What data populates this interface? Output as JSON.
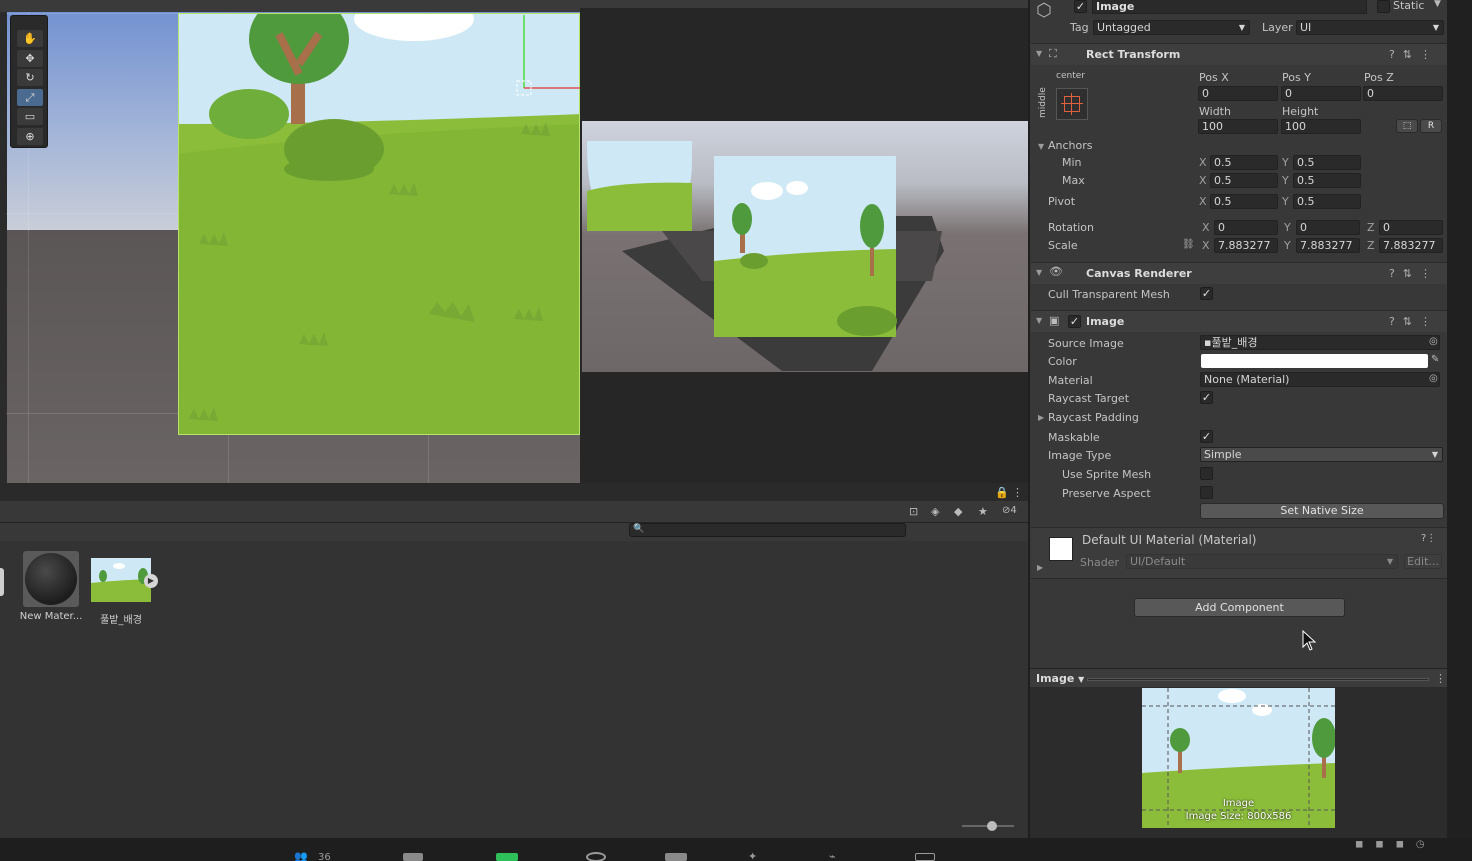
{
  "scene": {
    "tools": [
      "hand-tool",
      "move-tool",
      "rotate-tool",
      "scale-tool",
      "rect-tool",
      "transform-tool"
    ]
  },
  "game": {},
  "project": {
    "hidden_count": "4",
    "assets": [
      {
        "label": "New Mater...",
        "icon": "material-sphere-icon"
      },
      {
        "label": "풀밭_배경",
        "icon": "sprite-thumbnail-icon"
      }
    ]
  },
  "inspector": {
    "object_name": "Image",
    "static_label": "Static",
    "tag_label": "Tag",
    "tag_value": "Untagged",
    "layer_label": "Layer",
    "layer_value": "UI",
    "rect_transform": {
      "title": "Rect Transform",
      "anchor_h": "center",
      "anchor_v": "middle",
      "pos_x_label": "Pos X",
      "pos_x": "0",
      "pos_y_label": "Pos Y",
      "pos_y": "0",
      "pos_z_label": "Pos Z",
      "pos_z": "0",
      "width_label": "Width",
      "width": "100",
      "height_label": "Height",
      "height": "100",
      "r_button": "R",
      "anchors_label": "Anchors",
      "min_label": "Min",
      "min_x": "0.5",
      "min_y": "0.5",
      "max_label": "Max",
      "max_x": "0.5",
      "max_y": "0.5",
      "pivot_label": "Pivot",
      "pivot_x": "0.5",
      "pivot_y": "0.5",
      "rotation_label": "Rotation",
      "rot_x": "0",
      "rot_y": "0",
      "rot_z": "0",
      "scale_label": "Scale",
      "scale_x": "7.883277",
      "scale_y": "7.883277",
      "scale_z": "7.883277",
      "axis_x": "X",
      "axis_y": "Y",
      "axis_z": "Z"
    },
    "canvas_renderer": {
      "title": "Canvas Renderer",
      "cull_label": "Cull Transparent Mesh",
      "cull_checked": true
    },
    "image": {
      "title": "Image",
      "source_image_label": "Source Image",
      "source_image": "풀밭_배경",
      "color_label": "Color",
      "color_value": "#ffffff",
      "material_label": "Material",
      "material": "None (Material)",
      "raycast_target_label": "Raycast Target",
      "raycast_padding_label": "Raycast Padding",
      "maskable_label": "Maskable",
      "image_type_label": "Image Type",
      "image_type": "Simple",
      "use_sprite_mesh_label": "Use Sprite Mesh",
      "preserve_aspect_label": "Preserve Aspect",
      "set_native_size": "Set Native Size"
    },
    "material": {
      "title": "Default UI Material (Material)",
      "shader_label": "Shader",
      "shader_value": "UI/Default",
      "edit_button": "Edit..."
    },
    "add_component": "Add Component",
    "preview": {
      "dropdown": "Image",
      "caption_name": "Image",
      "caption_size": "Image Size: 800x586"
    }
  },
  "taskbar": {
    "participants": "36"
  },
  "colors": {
    "accent_blue": "#4b6a8f",
    "grass": "#8bbd3a",
    "sky": "#cfe8f5"
  }
}
